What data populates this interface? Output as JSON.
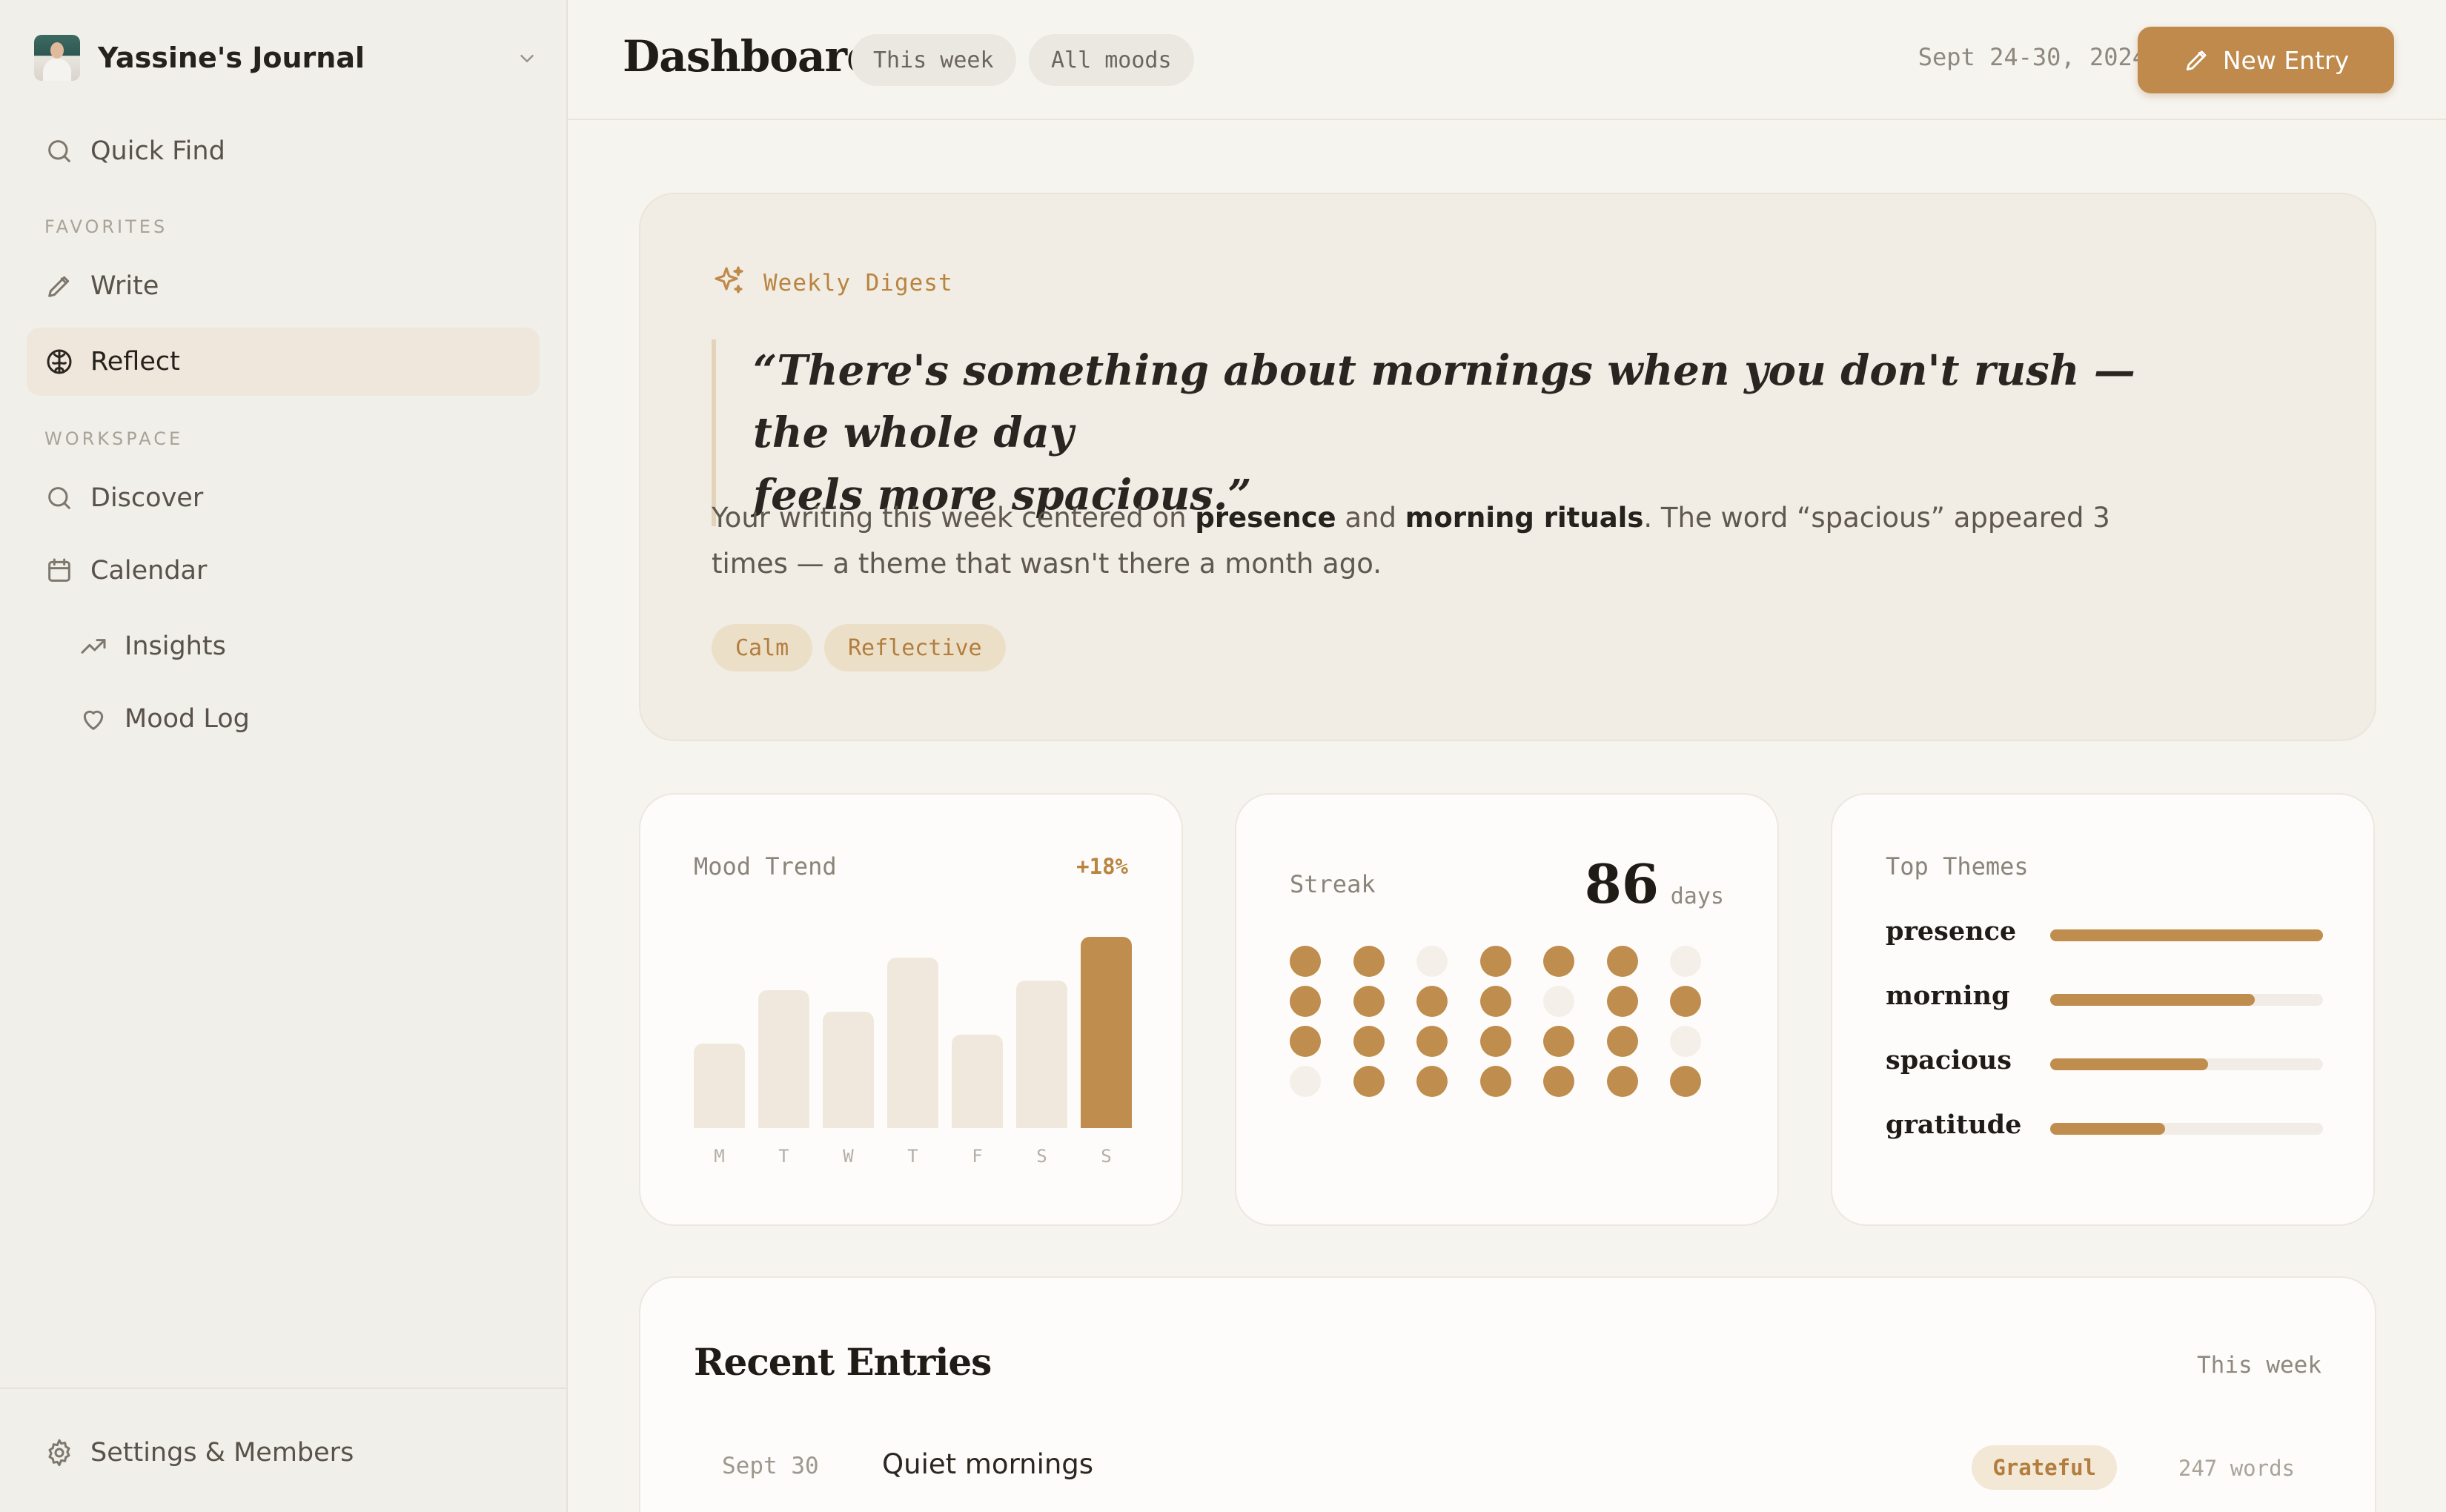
{
  "workspace": {
    "name": "Yassine's Journal"
  },
  "sidebar": {
    "quick_find": "Quick Find",
    "favorites_label": "FAVORITES",
    "workspace_label": "WORKSPACE",
    "items": [
      {
        "label": "Write",
        "icon": "pencil-icon"
      },
      {
        "label": "Reflect",
        "icon": "brain-icon",
        "active": true
      },
      {
        "label": "Discover",
        "icon": "search-icon"
      },
      {
        "label": "Calendar",
        "icon": "calendar-icon"
      },
      {
        "label": "Insights",
        "icon": "trending-up-icon"
      },
      {
        "label": "Mood Log",
        "icon": "heart-icon"
      }
    ],
    "footer": "Settings & Members"
  },
  "header": {
    "title": "Dashboard",
    "filters": [
      "This week",
      "All moods"
    ],
    "date_range": "Sept 24-30, 2024",
    "new_entry": "New Entry"
  },
  "digest": {
    "label": "Weekly Digest",
    "quote_line1": "“There's something about mornings when you don't rush — the whole day",
    "quote_line2": "feels more spacious.”",
    "summary_parts": [
      "Your writing this week centered on ",
      "presence",
      " and ",
      "morning rituals",
      ". The word “spacious” appeared 3 times — a theme that wasn't there a month ago."
    ],
    "tags": [
      "Calm",
      "Reflective"
    ]
  },
  "mood_trend": {
    "title": "Mood Trend",
    "change": "+18%"
  },
  "streak": {
    "title": "Streak",
    "count": "86",
    "unit": "days",
    "grid": [
      [
        1,
        1,
        0,
        1,
        1,
        1,
        0
      ],
      [
        1,
        1,
        1,
        1,
        0,
        1,
        1
      ],
      [
        1,
        1,
        1,
        1,
        1,
        1,
        0
      ],
      [
        0,
        1,
        1,
        1,
        1,
        1,
        1
      ]
    ]
  },
  "top_themes": {
    "title": "Top Themes",
    "items": [
      {
        "label": "presence",
        "value": 1.0
      },
      {
        "label": "morning",
        "value": 0.75
      },
      {
        "label": "spacious",
        "value": 0.58
      },
      {
        "label": "gratitude",
        "value": 0.42
      }
    ]
  },
  "chart_data": {
    "type": "bar",
    "categories": [
      "M",
      "T",
      "W",
      "T",
      "F",
      "S",
      "S"
    ],
    "values": [
      0.44,
      0.72,
      0.61,
      0.89,
      0.49,
      0.77,
      1.0
    ],
    "highlight_index": 6,
    "colors": {
      "bar": "#f1e8dd",
      "highlight": "#bf8d4d"
    }
  },
  "recent": {
    "title": "Recent Entries",
    "filter": "This week",
    "entries": [
      {
        "date": "Sept 30",
        "title": "Quiet mornings",
        "mood": "Grateful",
        "words": "247 words"
      }
    ]
  },
  "colors": {
    "accent": "#bf8a4c",
    "background": "#f6f4ef",
    "sidebar": "#f1efea"
  }
}
